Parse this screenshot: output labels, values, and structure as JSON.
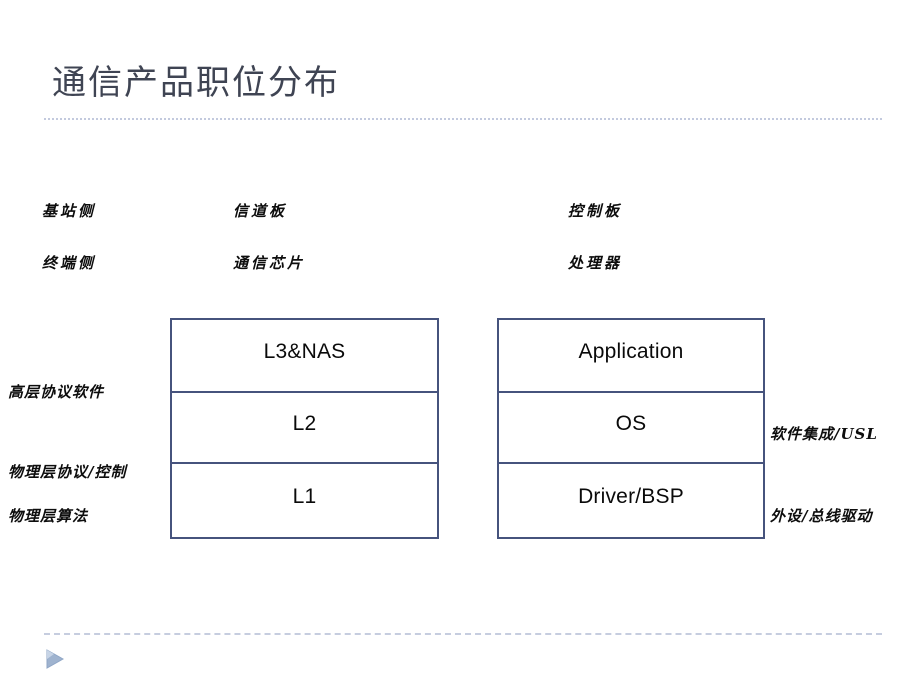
{
  "slide": {
    "title": "通信产品职位分布",
    "accent_color": "#46537d",
    "rule_color": "#c3cade",
    "title_color": "#3f4453",
    "background": "#ffffff"
  },
  "matrix": {
    "rows": [
      {
        "side": "基站侧",
        "middle": "信道板",
        "right": "控制板"
      },
      {
        "side": "终端侧",
        "middle": "通信芯片",
        "right": "处理器"
      }
    ]
  },
  "stacks": [
    {
      "name": "protocol-stack",
      "layers": [
        "L3&NAS",
        "L2",
        "L1"
      ]
    },
    {
      "name": "software-stack",
      "layers": [
        "Application",
        "OS",
        "Driver/BSP"
      ]
    }
  ],
  "annotations": {
    "left": [
      "高层协议软件",
      "物理层协议/控制",
      "物理层算法"
    ],
    "right": [
      "软件集成/USL",
      "外设/总线驱动"
    ]
  },
  "footer": {
    "marker_icon": "play-triangle-icon",
    "marker_color": "#92a8c8"
  }
}
